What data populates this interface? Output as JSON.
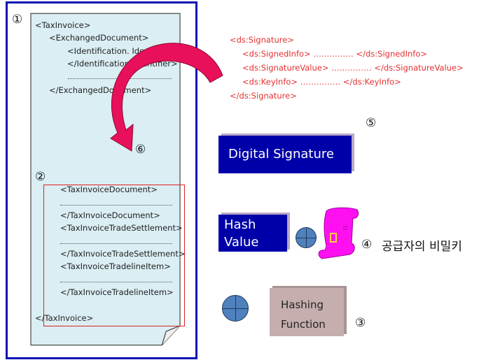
{
  "markers": {
    "m1": "①",
    "m2": "②",
    "m3": "③",
    "m4": "④",
    "m5": "⑤",
    "m6": "⑥"
  },
  "invoice": {
    "lines": [
      "<TaxInvoice>",
      "<ExchangedDocument>",
      "<Identification. Identifier>",
      "</Identification. Identifier>",
      "</ExchangedDocument>",
      "<TaxInvoiceDocument>",
      "</TaxInvoiceDocument>",
      "<TaxInvoiceTradeSettlement>",
      "</TaxInvoiceTradeSettlement>",
      "<TaxInvoiceTradelineItem>",
      "</TaxInvoiceTradelineItem>",
      "</TaxInvoice>"
    ]
  },
  "signature_xml": [
    "<ds:Signature>",
    "<ds:SignedInfo>  ……………  </ds:SignedInfo>",
    "<ds:SignatureValue>  ……………  </ds:SignatureValue>",
    "<ds:KeyInfo>  ……………  </ds:KeyInfo>",
    "</ds:Signature>"
  ],
  "boxes": {
    "digital_signature": "Digital Signature",
    "hash_value_1": "Hash",
    "hash_value_2": "Value",
    "hashing_function_1": "Hashing",
    "hashing_function_2": "Function"
  },
  "private_key_label": "공급자의 비밀키",
  "colors": {
    "border": "#0a14b4",
    "document": "#daeef3",
    "arrow": "#e8105a",
    "signature_text": "#e53030",
    "dark_box": "#0000a8",
    "hash_fn_box": "#c6aeae",
    "plus": "#4f81bd",
    "key": "#ff00ff"
  }
}
